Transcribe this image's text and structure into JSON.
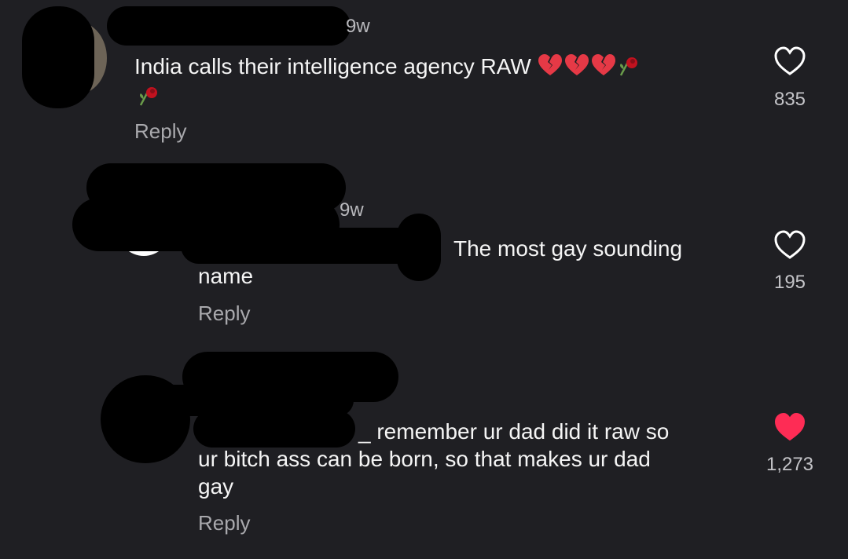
{
  "comments": [
    {
      "time": "9w",
      "text": "India calls their intelligence agency RAW",
      "reply_label": "Reply",
      "likes": "835",
      "liked": false,
      "emojis": [
        "broken-heart-icon",
        "broken-heart-icon",
        "broken-heart-icon",
        "wilted-rose-icon",
        "wilted-rose-icon"
      ]
    },
    {
      "time": "9w",
      "text_line1": "The most gay sounding",
      "text_line2": "name",
      "reply_label": "Reply",
      "likes": "195",
      "liked": false
    },
    {
      "time": "",
      "text_line1": "_ remember ur dad did it raw so",
      "text_line2": "ur bitch ass can be born, so that makes ur dad",
      "text_line3": "gay",
      "reply_label": "Reply",
      "likes": "1,273",
      "liked": true
    }
  ],
  "colors": {
    "background": "#1f1f23",
    "liked_heart": "#fe2c55",
    "outline_heart": "#ffffff",
    "broken_heart": "#e63946"
  }
}
